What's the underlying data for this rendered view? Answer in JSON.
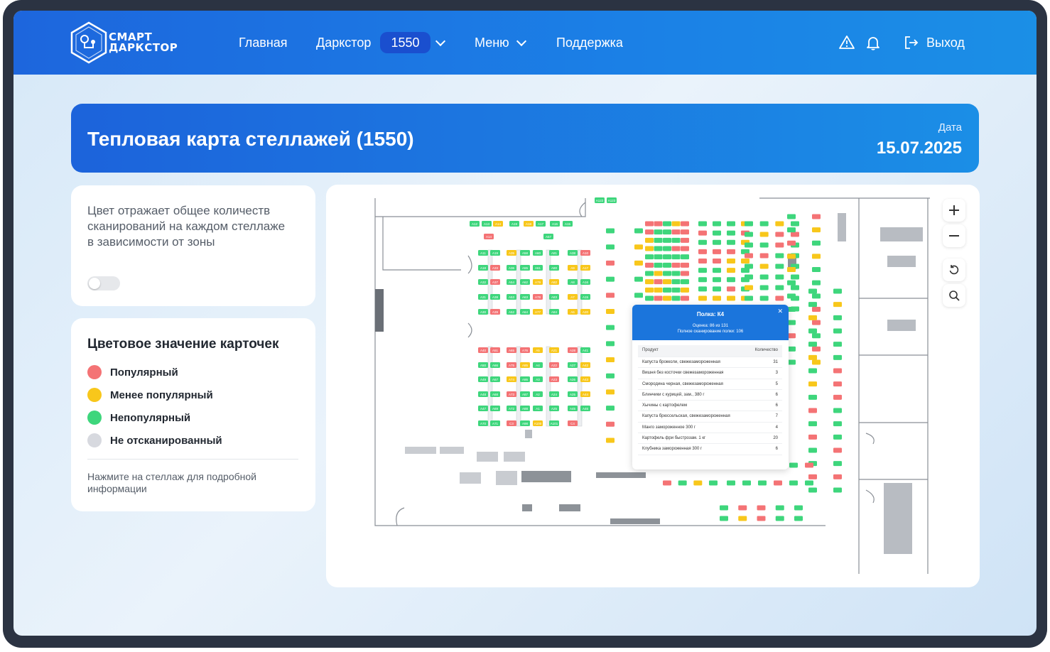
{
  "app": {
    "logo_line1": "СМАРТ",
    "logo_line2": "ДАРКСТОР"
  },
  "nav": {
    "home": "Главная",
    "darkstore": "Даркстор",
    "darkstore_id": "1550",
    "menu": "Меню",
    "support": "Поддержка",
    "logout": "Выход"
  },
  "header": {
    "title": "Тепловая карта стеллажей (1550)",
    "date_label": "Дата",
    "date_value": "15.07.2025"
  },
  "info_card": {
    "text": "Цвет отражает общее количеств сканирований на каждом стеллаже в зависимости от зоны",
    "toggle_on": false
  },
  "legend": {
    "title": "Цветовое значение карточек",
    "items": [
      {
        "label": "Популярный",
        "color": "#f47375"
      },
      {
        "label": "Менее популярный",
        "color": "#f8c71b"
      },
      {
        "label": "Непопулярный",
        "color": "#3ed67c"
      },
      {
        "label": "Не отсканированный",
        "color": "#d7d9df"
      }
    ],
    "hint": "Нажмите на стеллаж для подробной информации"
  },
  "colors": {
    "popular": "#f47375",
    "less_popular": "#f8c71b",
    "unpopular": "#3ed67c",
    "unscanned": "#d7d9df",
    "primary": "#1b6fdf"
  },
  "map": {
    "popup": {
      "title": "Полка: К4",
      "score": "Оценка: 86 из 131",
      "full_scan": "Полное сканирование полки: 106",
      "col_product": "Продукт",
      "col_qty": "Количество",
      "rows": [
        {
          "name": "Капуста брокколи, свежезамороженная",
          "qty": "31"
        },
        {
          "name": "Вишня без косточки свежезамороженная",
          "qty": "3"
        },
        {
          "name": "Смородина черная, свежезамороженная",
          "qty": "5"
        },
        {
          "name": "Блинчики с курицей, зам., 380 г",
          "qty": "6"
        },
        {
          "name": "Хычины с картофелем",
          "qty": "6"
        },
        {
          "name": "Капуста брюссельская, свежезамороженная",
          "qty": "7"
        },
        {
          "name": "Манго замороженное 300 г",
          "qty": "4"
        },
        {
          "name": "Картофель фри быстрозам. 1 кг",
          "qty": "20"
        },
        {
          "name": "Клубника замороженная 300 г",
          "qty": "6"
        }
      ]
    },
    "tags": [
      {
        "id": "A12",
        "c": "g"
      },
      {
        "id": "A13",
        "c": "g"
      },
      {
        "id": "A14",
        "c": "y"
      },
      {
        "id": "A19",
        "c": "g"
      },
      {
        "id": "A18",
        "c": "y"
      },
      {
        "id": "A17",
        "c": "g"
      },
      {
        "id": "A16",
        "c": "g"
      },
      {
        "id": "A15",
        "c": "g"
      },
      {
        "id": "A122",
        "c": "g"
      },
      {
        "id": "A123",
        "c": "g"
      },
      {
        "id": "A14",
        "c": "r"
      },
      {
        "id": "A57",
        "c": "g"
      },
      {
        "id": "A11",
        "c": "g"
      },
      {
        "id": "A19",
        "c": "g"
      },
      {
        "id": "A35",
        "c": "y"
      },
      {
        "id": "A58",
        "c": "g"
      },
      {
        "id": "A60",
        "c": "g"
      },
      {
        "id": "A81",
        "c": "g"
      },
      {
        "id": "A38",
        "c": "g"
      },
      {
        "id": "A10",
        "c": "r"
      },
      {
        "id": "A18",
        "c": "g"
      },
      {
        "id": "A33",
        "c": "r"
      },
      {
        "id": "A36",
        "c": "g"
      },
      {
        "id": "A55",
        "c": "g"
      },
      {
        "id": "A61",
        "c": "g"
      },
      {
        "id": "A80",
        "c": "g"
      },
      {
        "id": "A9",
        "c": "y"
      },
      {
        "id": "A17",
        "c": "y"
      },
      {
        "id": "A32",
        "c": "g"
      },
      {
        "id": "A37",
        "c": "r"
      },
      {
        "id": "A54",
        "c": "g"
      },
      {
        "id": "A62",
        "c": "g"
      },
      {
        "id": "A79",
        "c": "y"
      },
      {
        "id": "A82",
        "c": "y"
      },
      {
        "id": "A8",
        "c": "g"
      },
      {
        "id": "A16",
        "c": "g"
      },
      {
        "id": "A31",
        "c": "g"
      },
      {
        "id": "A38",
        "c": "g"
      },
      {
        "id": "A53",
        "c": "g"
      },
      {
        "id": "A63",
        "c": "g"
      },
      {
        "id": "A78",
        "c": "r"
      },
      {
        "id": "A83",
        "c": "g"
      },
      {
        "id": "A7",
        "c": "y"
      },
      {
        "id": "A15",
        "c": "g"
      },
      {
        "id": "A30",
        "c": "g"
      },
      {
        "id": "A39",
        "c": "r"
      },
      {
        "id": "A52",
        "c": "g"
      },
      {
        "id": "A64",
        "c": "g"
      },
      {
        "id": "A77",
        "c": "y"
      },
      {
        "id": "A84",
        "c": "g"
      },
      {
        "id": "A6",
        "c": "y"
      },
      {
        "id": "A20",
        "c": "y"
      },
      {
        "id": "A40",
        "c": "r"
      },
      {
        "id": "A51",
        "c": "r"
      },
      {
        "id": "A65",
        "c": "r"
      },
      {
        "id": "A76",
        "c": "r"
      },
      {
        "id": "A5",
        "c": "y"
      },
      {
        "id": "A21",
        "c": "y"
      },
      {
        "id": "A28",
        "c": "r"
      },
      {
        "id": "A41",
        "c": "g"
      },
      {
        "id": "A50",
        "c": "g"
      },
      {
        "id": "A66",
        "c": "g"
      },
      {
        "id": "A75",
        "c": "r"
      },
      {
        "id": "A85",
        "c": "y"
      },
      {
        "id": "A4",
        "c": "g"
      },
      {
        "id": "A22",
        "c": "r"
      },
      {
        "id": "A27",
        "c": "g"
      },
      {
        "id": "A42",
        "c": "y"
      },
      {
        "id": "A49",
        "c": "g"
      },
      {
        "id": "A67",
        "c": "g"
      },
      {
        "id": "A74",
        "c": "y"
      },
      {
        "id": "A86",
        "c": "g"
      },
      {
        "id": "A3",
        "c": "g"
      },
      {
        "id": "A23",
        "c": "r"
      },
      {
        "id": "A26",
        "c": "g"
      },
      {
        "id": "A43",
        "c": "y"
      },
      {
        "id": "A48",
        "c": "g"
      },
      {
        "id": "A68",
        "c": "g"
      },
      {
        "id": "A73",
        "c": "r"
      },
      {
        "id": "A87",
        "c": "g"
      },
      {
        "id": "A2",
        "c": "g"
      },
      {
        "id": "A24",
        "c": "g"
      },
      {
        "id": "A25",
        "c": "g"
      },
      {
        "id": "A44",
        "c": "y"
      },
      {
        "id": "A47",
        "c": "g"
      },
      {
        "id": "A69",
        "c": "g"
      },
      {
        "id": "A72",
        "c": "g"
      },
      {
        "id": "A88",
        "c": "g"
      },
      {
        "id": "A1",
        "c": "g"
      },
      {
        "id": "A25",
        "c": "g"
      },
      {
        "id": "A45",
        "c": "g"
      },
      {
        "id": "A46",
        "c": "g"
      },
      {
        "id": "A70",
        "c": "g"
      },
      {
        "id": "A71",
        "c": "g"
      },
      {
        "id": "C3",
        "c": "r"
      },
      {
        "id": "A98",
        "c": "g"
      },
      {
        "id": "A100",
        "c": "y"
      },
      {
        "id": "A101",
        "c": "g"
      },
      {
        "id": "C4",
        "c": "r"
      }
    ]
  }
}
